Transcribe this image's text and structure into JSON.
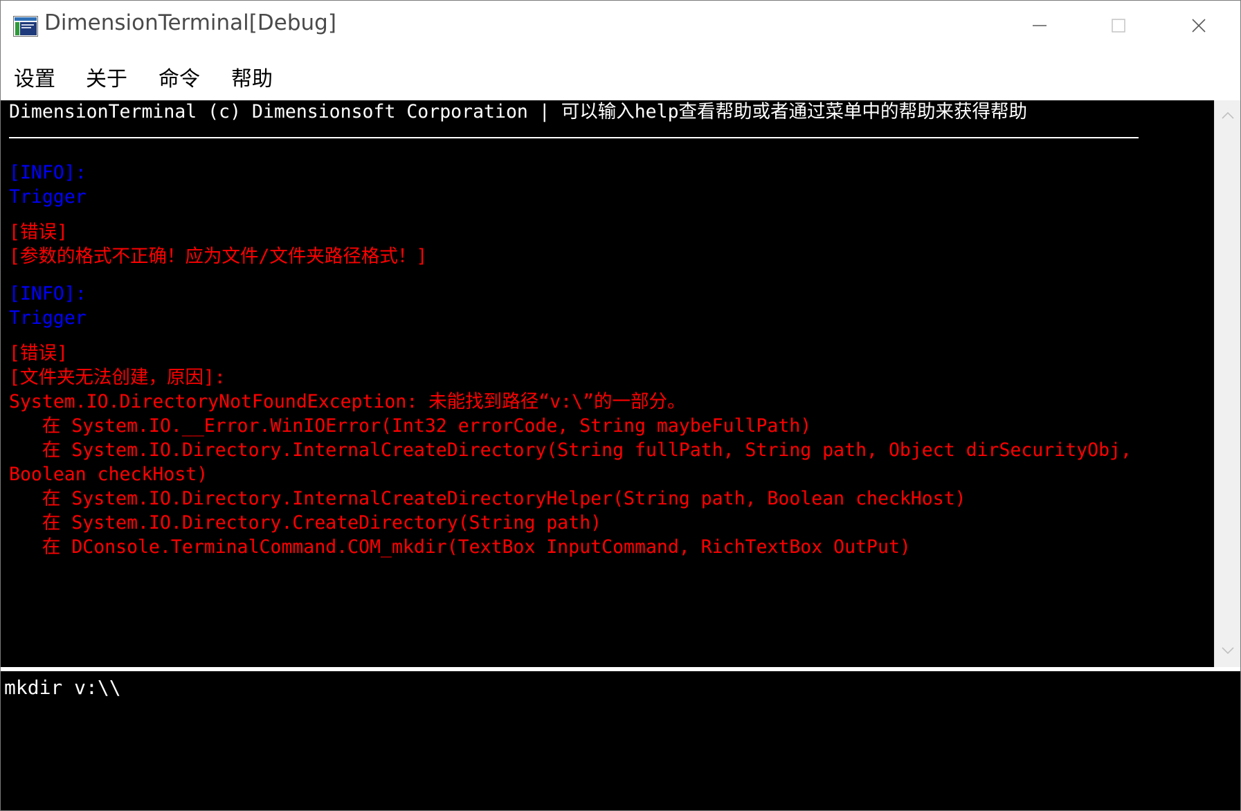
{
  "window": {
    "title": "DimensionTerminal[Debug]",
    "icon": "app-icon"
  },
  "title_buttons": [
    "minimize-icon",
    "maximize-icon",
    "close-icon"
  ],
  "menu": {
    "items": [
      {
        "label": "设置"
      },
      {
        "label": "关于"
      },
      {
        "label": "命令"
      },
      {
        "label": "帮助"
      }
    ]
  },
  "output": {
    "header": "DimensionTerminal (c) Dimensionsoft Corporation | 可以输入help查看帮助或者通过菜单中的帮助来获得帮助",
    "lines": [
      {
        "text": "[INFO]:",
        "color": "blue"
      },
      {
        "text": "Trigger",
        "color": "blue"
      },
      {
        "text": "[错误]",
        "color": "red"
      },
      {
        "text": "[参数的格式不正确！应为文件/文件夹路径格式！]",
        "color": "red"
      },
      {
        "text": "[INFO]:",
        "color": "blue"
      },
      {
        "text": "Trigger",
        "color": "blue"
      },
      {
        "text": "[错误]",
        "color": "red"
      },
      {
        "text": "[文件夹无法创建，原因]:",
        "color": "red"
      },
      {
        "text": "System.IO.DirectoryNotFoundException: 未能找到路径“v:\\”的一部分。",
        "color": "red"
      },
      {
        "text": "   在 System.IO.__Error.WinIOError(Int32 errorCode, String maybeFullPath)",
        "color": "red"
      },
      {
        "text": "   在 System.IO.Directory.InternalCreateDirectory(String fullPath, String path, Object dirSecurityObj,",
        "color": "red"
      },
      {
        "text": "Boolean checkHost)",
        "color": "red"
      },
      {
        "text": "   在 System.IO.Directory.InternalCreateDirectoryHelper(String path, Boolean checkHost)",
        "color": "red"
      },
      {
        "text": "   在 System.IO.Directory.CreateDirectory(String path)",
        "color": "red"
      },
      {
        "text": "   在 DConsole.TerminalCommand.COM_mkdir(TextBox InputCommand, RichTextBox OutPut)",
        "color": "red"
      }
    ]
  },
  "input": {
    "value": "mkdir v:\\\\"
  },
  "colors": {
    "info": "#0000ff",
    "error": "#ff0000",
    "background": "#000000",
    "text": "#ffffff"
  }
}
